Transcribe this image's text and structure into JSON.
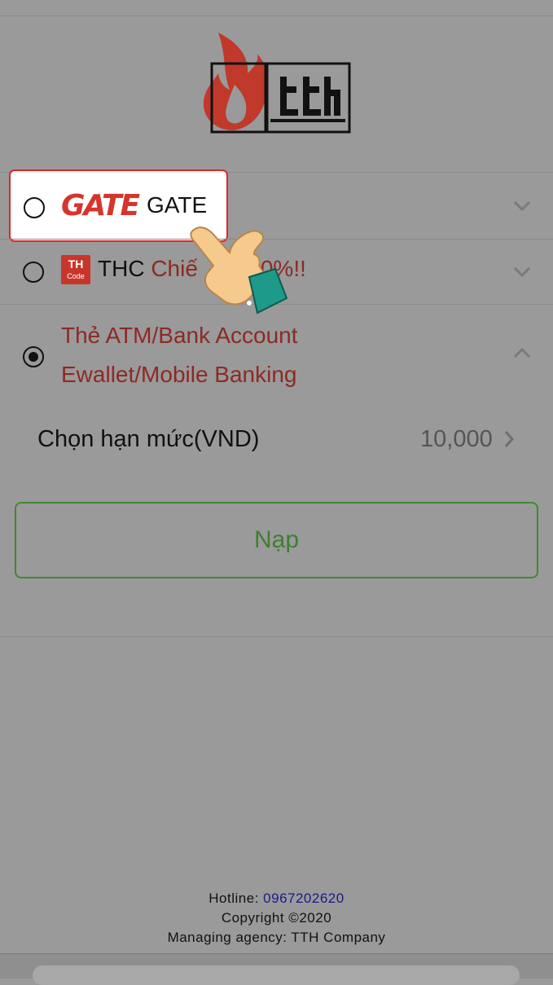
{
  "logo": {
    "text": "tth"
  },
  "options": [
    {
      "id": "gate",
      "logo_text": "GATE",
      "label": "GATE",
      "selected": false,
      "highlighted": true
    },
    {
      "id": "thc",
      "badge_top": "TH",
      "badge_bottom": "Code",
      "label": "THC",
      "promo_visible": "Chiế",
      "promo_hidden_tail": "u 10%!!",
      "selected": false
    },
    {
      "id": "atm",
      "line1": "Thẻ ATM/Bank Account",
      "line2": "Ewallet/Mobile Banking",
      "selected": true,
      "expanded": true
    }
  ],
  "limit": {
    "label": "Chọn hạn mức(VND)",
    "value": "10,000"
  },
  "submit": {
    "label": "Nạp"
  },
  "footer": {
    "hotline_label": "Hotline: ",
    "hotline_number": "0967202620",
    "copyright": "Copyright ©2020",
    "agency": "Managing agency: TTH Company"
  },
  "colors": {
    "overlay_bg": "#9a9a9a",
    "highlight_border": "#e0262a",
    "promo_text": "#8c2a24",
    "button_border": "#3e8a2e",
    "hotline_link": "#1a1a8c"
  },
  "icons": [
    "fire-logo-icon",
    "chevron-down-icon",
    "chevron-up-icon",
    "chevron-right-icon",
    "pointing-hand-icon"
  ]
}
